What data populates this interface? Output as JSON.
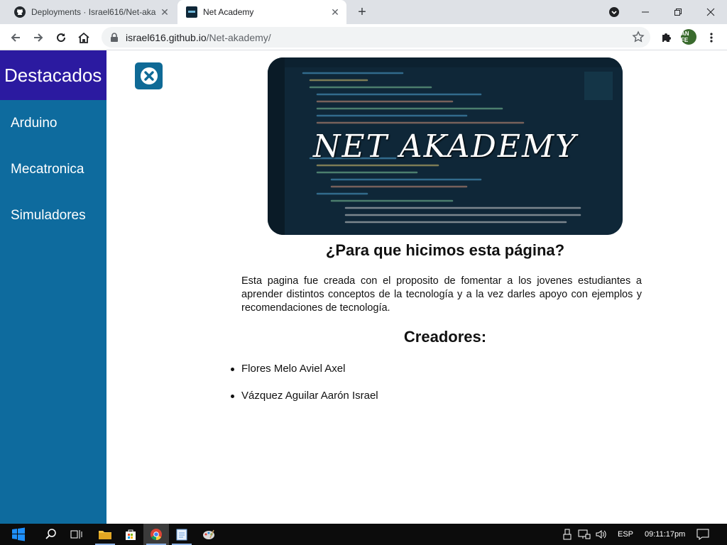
{
  "browser": {
    "tabs": [
      {
        "title": "Deployments · Israel616/Net-aka",
        "active": false
      },
      {
        "title": "Net Academy",
        "active": true
      }
    ],
    "url_host": "israel616.github.io",
    "url_path": "/Net-akademy/",
    "profile_initials": "AN FE"
  },
  "sidebar": {
    "heading": "Destacados",
    "items": [
      {
        "label": "Arduino"
      },
      {
        "label": "Mecatronica"
      },
      {
        "label": "Simuladores"
      }
    ]
  },
  "main": {
    "banner_text": "NET AKADEMY",
    "question_heading": "¿Para que hicimos esta página?",
    "intro": "Esta pagina fue creada con el proposito de fomentar a los jovenes estudiantes a aprender distintos conceptos de la tecnología y a la vez darles apoyo con ejemplos y recomendaciones de tecnología.",
    "creators_heading": "Creadores:",
    "creators": [
      "Flores Melo Aviel Axel",
      "Vázquez Aguilar Aarón Israel"
    ]
  },
  "taskbar": {
    "language": "ESP",
    "time": "09:11:17pm"
  },
  "colors": {
    "sidebar": "#0e6b9e",
    "sidebar_heading": "#2b1aa0",
    "close_button": "#0f6a96"
  }
}
